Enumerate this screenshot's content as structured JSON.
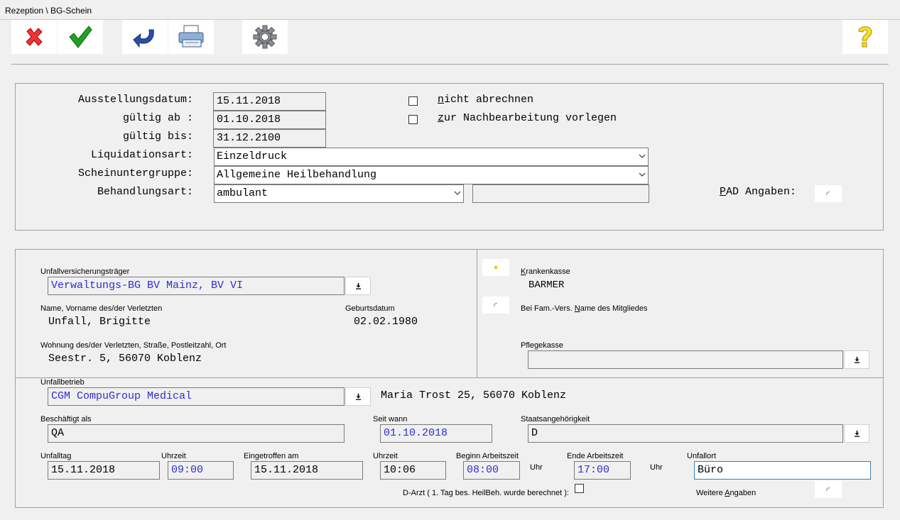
{
  "window": {
    "title": "Rezeption \\ BG-Schein"
  },
  "header": {
    "ausstellungsdatum_label": "Ausstellungsdatum:",
    "ausstellungsdatum": "15.11.2018",
    "gueltig_ab_label": "gültig ab :",
    "gueltig_ab": "01.10.2018",
    "gueltig_bis_label": "gültig bis:",
    "gueltig_bis": "31.12.2100",
    "liquidationsart_label": "Liquidationsart:",
    "liquidationsart": "Einzeldruck",
    "scheinuntergruppe_label": "Scheinuntergruppe:",
    "scheinuntergruppe": "Allgemeine Heilbehandlung",
    "behandlungsart_label": "Behandlungsart:",
    "behandlungsart": "ambulant",
    "behandlungsart_extra": "",
    "nicht_abrechnen_first": "n",
    "nicht_abrechnen_rest": "icht abrechnen",
    "nachbearbeitung_first": "z",
    "nachbearbeitung_rest": "ur Nachbearbeitung vorlegen",
    "pad_first": "P",
    "pad_rest": "AD Angaben:"
  },
  "insurer": {
    "traeger_label": "Unfallversicherungsträger",
    "traeger": "Verwaltungs-BG BV Mainz, BV VI",
    "name_label": "Name, Vorname des/der Verletzten",
    "name": "Unfall, Brigitte",
    "geburtsdatum_label": "Geburtsdatum",
    "geburtsdatum": "02.02.1980",
    "wohnung_label": "Wohnung des/der Verletzten, Straße, Postleitzahl, Ort",
    "wohnung": "Seestr. 5, 56070 Koblenz"
  },
  "kasse": {
    "krankenkasse_first": "K",
    "krankenkasse_rest": "rankenkasse",
    "krankenkasse": "BARMER",
    "famvers_pre": "Bei Fam.-Vers. ",
    "famvers_u": "N",
    "famvers_post": "ame des Mitgliedes",
    "pflegekasse_label": "Pflegekasse",
    "pflegekasse": ""
  },
  "betrieb": {
    "label": "Unfallbetrieb",
    "name": "CGM CompuGroup Medical",
    "adresse": "Maria Trost 25, 56070 Koblenz",
    "beschaeftigt_label": "Beschäftigt als",
    "beschaeftigt": "QA",
    "seit_label": "Seit wann",
    "seit": "01.10.2018",
    "staat_label": "Staatsangehörigkeit",
    "staat": "D"
  },
  "unfall": {
    "tag_label": "Unfalltag",
    "tag": "15.11.2018",
    "uhrzeit_label": "Uhrzeit",
    "uhrzeit": "09:00",
    "eingetroffen_label": "Eingetroffen am",
    "eingetroffen": "15.11.2018",
    "uhrzeit2_label": "Uhrzeit",
    "uhrzeit2": "10:06",
    "beginn_label": "Beginn Arbeitszeit",
    "beginn": "08:00",
    "uhr1": "Uhr",
    "ende_label": "Ende Arbeitszeit",
    "ende": "17:00",
    "uhr2": "Uhr",
    "ort_label": "Unfallort",
    "ort": "Büro",
    "darzt_label": "D-Arzt ( 1. Tag bes. HeilBeh. wurde berechnet ):",
    "weitere_pre": "Weitere ",
    "weitere_u": "A",
    "weitere_post": "ngaben"
  },
  "icons": [
    "close-icon",
    "check-icon",
    "undo-icon",
    "printer-icon",
    "gear-icon",
    "help-icon",
    "download-icon",
    "radio-icon",
    "chevron-down-icon"
  ]
}
